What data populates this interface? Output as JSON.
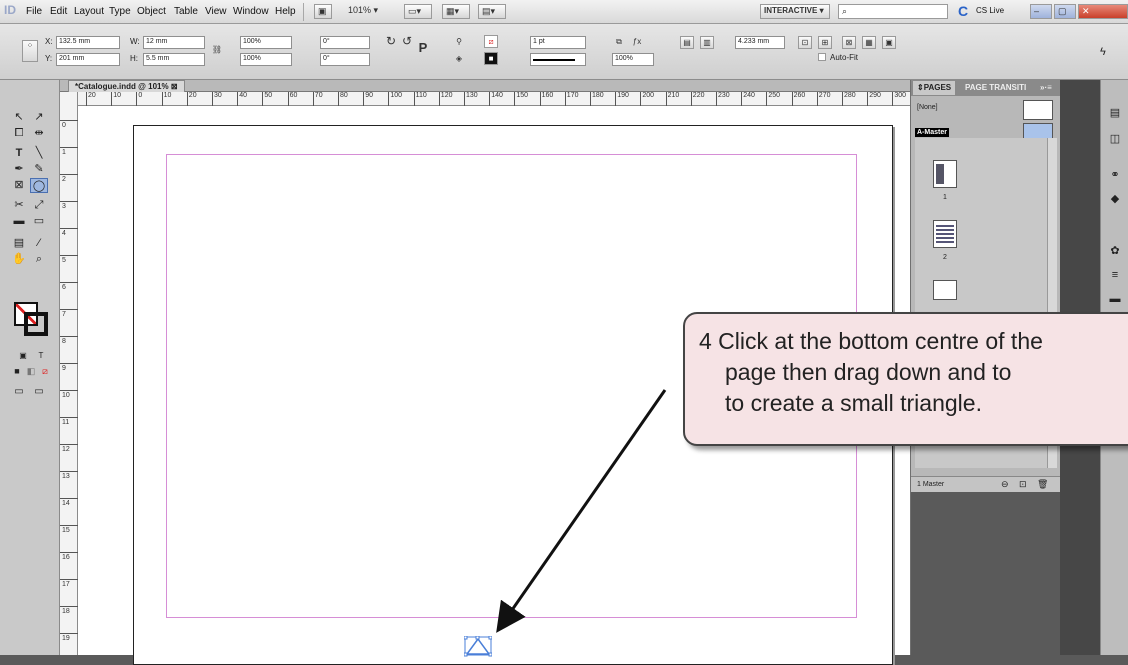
{
  "menubar": {
    "logo": "ID",
    "items": [
      "File",
      "Edit",
      "Layout",
      "Type",
      "Object",
      "Table",
      "View",
      "Window",
      "Help"
    ],
    "zoom": "101%",
    "workspace": "INTERACTIVE",
    "cslive": "CS Live"
  },
  "control_panel": {
    "x": "132.5 mm",
    "y": "201 mm",
    "w": "12 mm",
    "h": "5.5 mm",
    "scale_x": "100%",
    "scale_y": "100%",
    "angle": "0°",
    "shear": "0°",
    "stroke": "1 pt",
    "opacity": "100%",
    "gutter": "4.233 mm",
    "autofit": "Auto-Fit"
  },
  "document_tab": "*Catalogue.indd @ 101%",
  "ruler": {
    "h_ticks": [
      "20",
      "10",
      "0",
      "10",
      "20",
      "30",
      "40",
      "50",
      "60",
      "70",
      "80",
      "90",
      "100",
      "110",
      "120",
      "130",
      "140",
      "150",
      "160",
      "170",
      "180",
      "190",
      "200",
      "210",
      "220",
      "230",
      "240",
      "250",
      "260",
      "270",
      "280",
      "290",
      "300"
    ],
    "v_ticks": [
      "0",
      "1",
      "2",
      "3",
      "4",
      "5",
      "6",
      "7",
      "8",
      "9",
      "10",
      "11",
      "12",
      "13",
      "14",
      "15",
      "16",
      "17",
      "18",
      "19"
    ]
  },
  "pages_panel": {
    "tab_pages": "PAGES",
    "tab_transitions": "PAGE TRANSITI",
    "none_label": "[None]",
    "master_label": "A-Master",
    "page_numbers": [
      "1",
      "2"
    ],
    "footer": "1 Master"
  },
  "callout": {
    "line1": "4  Click at the bottom centre of the",
    "line2": "page then drag down and to",
    "line3": "to create a small triangle."
  },
  "colors": {
    "margin": "#d68ed6",
    "callout_bg": "#f6e3e5",
    "selection": "#4a7fd8"
  }
}
